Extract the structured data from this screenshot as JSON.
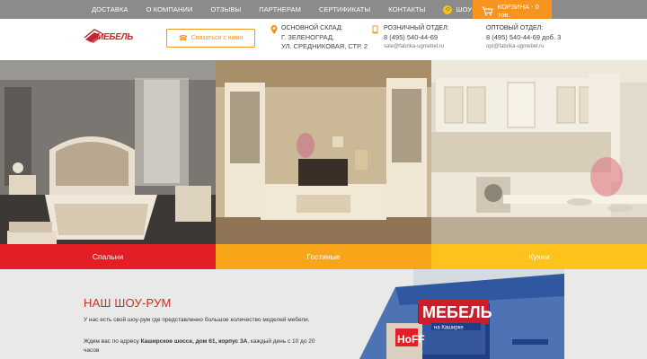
{
  "nav": {
    "items": [
      "Доставка",
      "О компании",
      "Отзывы",
      "Партнерам",
      "Сертификаты",
      "Контакты",
      "Шоу-рум"
    ],
    "cart_label": "КОРЗИНА - 0 тов."
  },
  "header": {
    "logo_text": "МЕБЕЛЬ",
    "call_button": "Связаться с нами",
    "warehouse": {
      "title": "ОСНОВНОЙ СКЛАД:",
      "line1": "Г. ЗЕЛЕНОГРАД,",
      "line2": "УЛ. СРЕДНИКОВАЯ, СТР. 2"
    },
    "retail": {
      "title": "РОЗНИЧНЫЙ ОТДЕЛ:",
      "phone": "8 (495) 540-44-69",
      "email": "sale@fabrika-ugmebel.ru"
    },
    "wholesale": {
      "title": "ОПТОВЫЙ ОТДЕЛ:",
      "phone": "8 (495) 540-44-69 доб. 3",
      "email": "opt@fabrika-ugmebel.ru"
    }
  },
  "gallery": {
    "categories": [
      "Спальни",
      "Гостиные",
      "Кухни"
    ]
  },
  "showroom": {
    "title": "НАШ ШОУ-РУМ",
    "p1": "У нас есть свой шоу-рум где представленно большое количество моделей мебели.",
    "p2_prefix": "Ждем вас по адресу ",
    "p2_address": "Каширское шоссе, дом 61, корпус 3А",
    "p2_suffix": ", каждый день с 10 до 20 часов",
    "building_sign": "МЕБЕЛЬ",
    "building_sub": "на Каширке",
    "building_logo": "HoFF"
  },
  "colors": {
    "accent": "#f7941d",
    "red": "#e31e24",
    "orange": "#f9a51a",
    "yellow": "#fdc21b",
    "topbar": "#8b8b8b"
  }
}
